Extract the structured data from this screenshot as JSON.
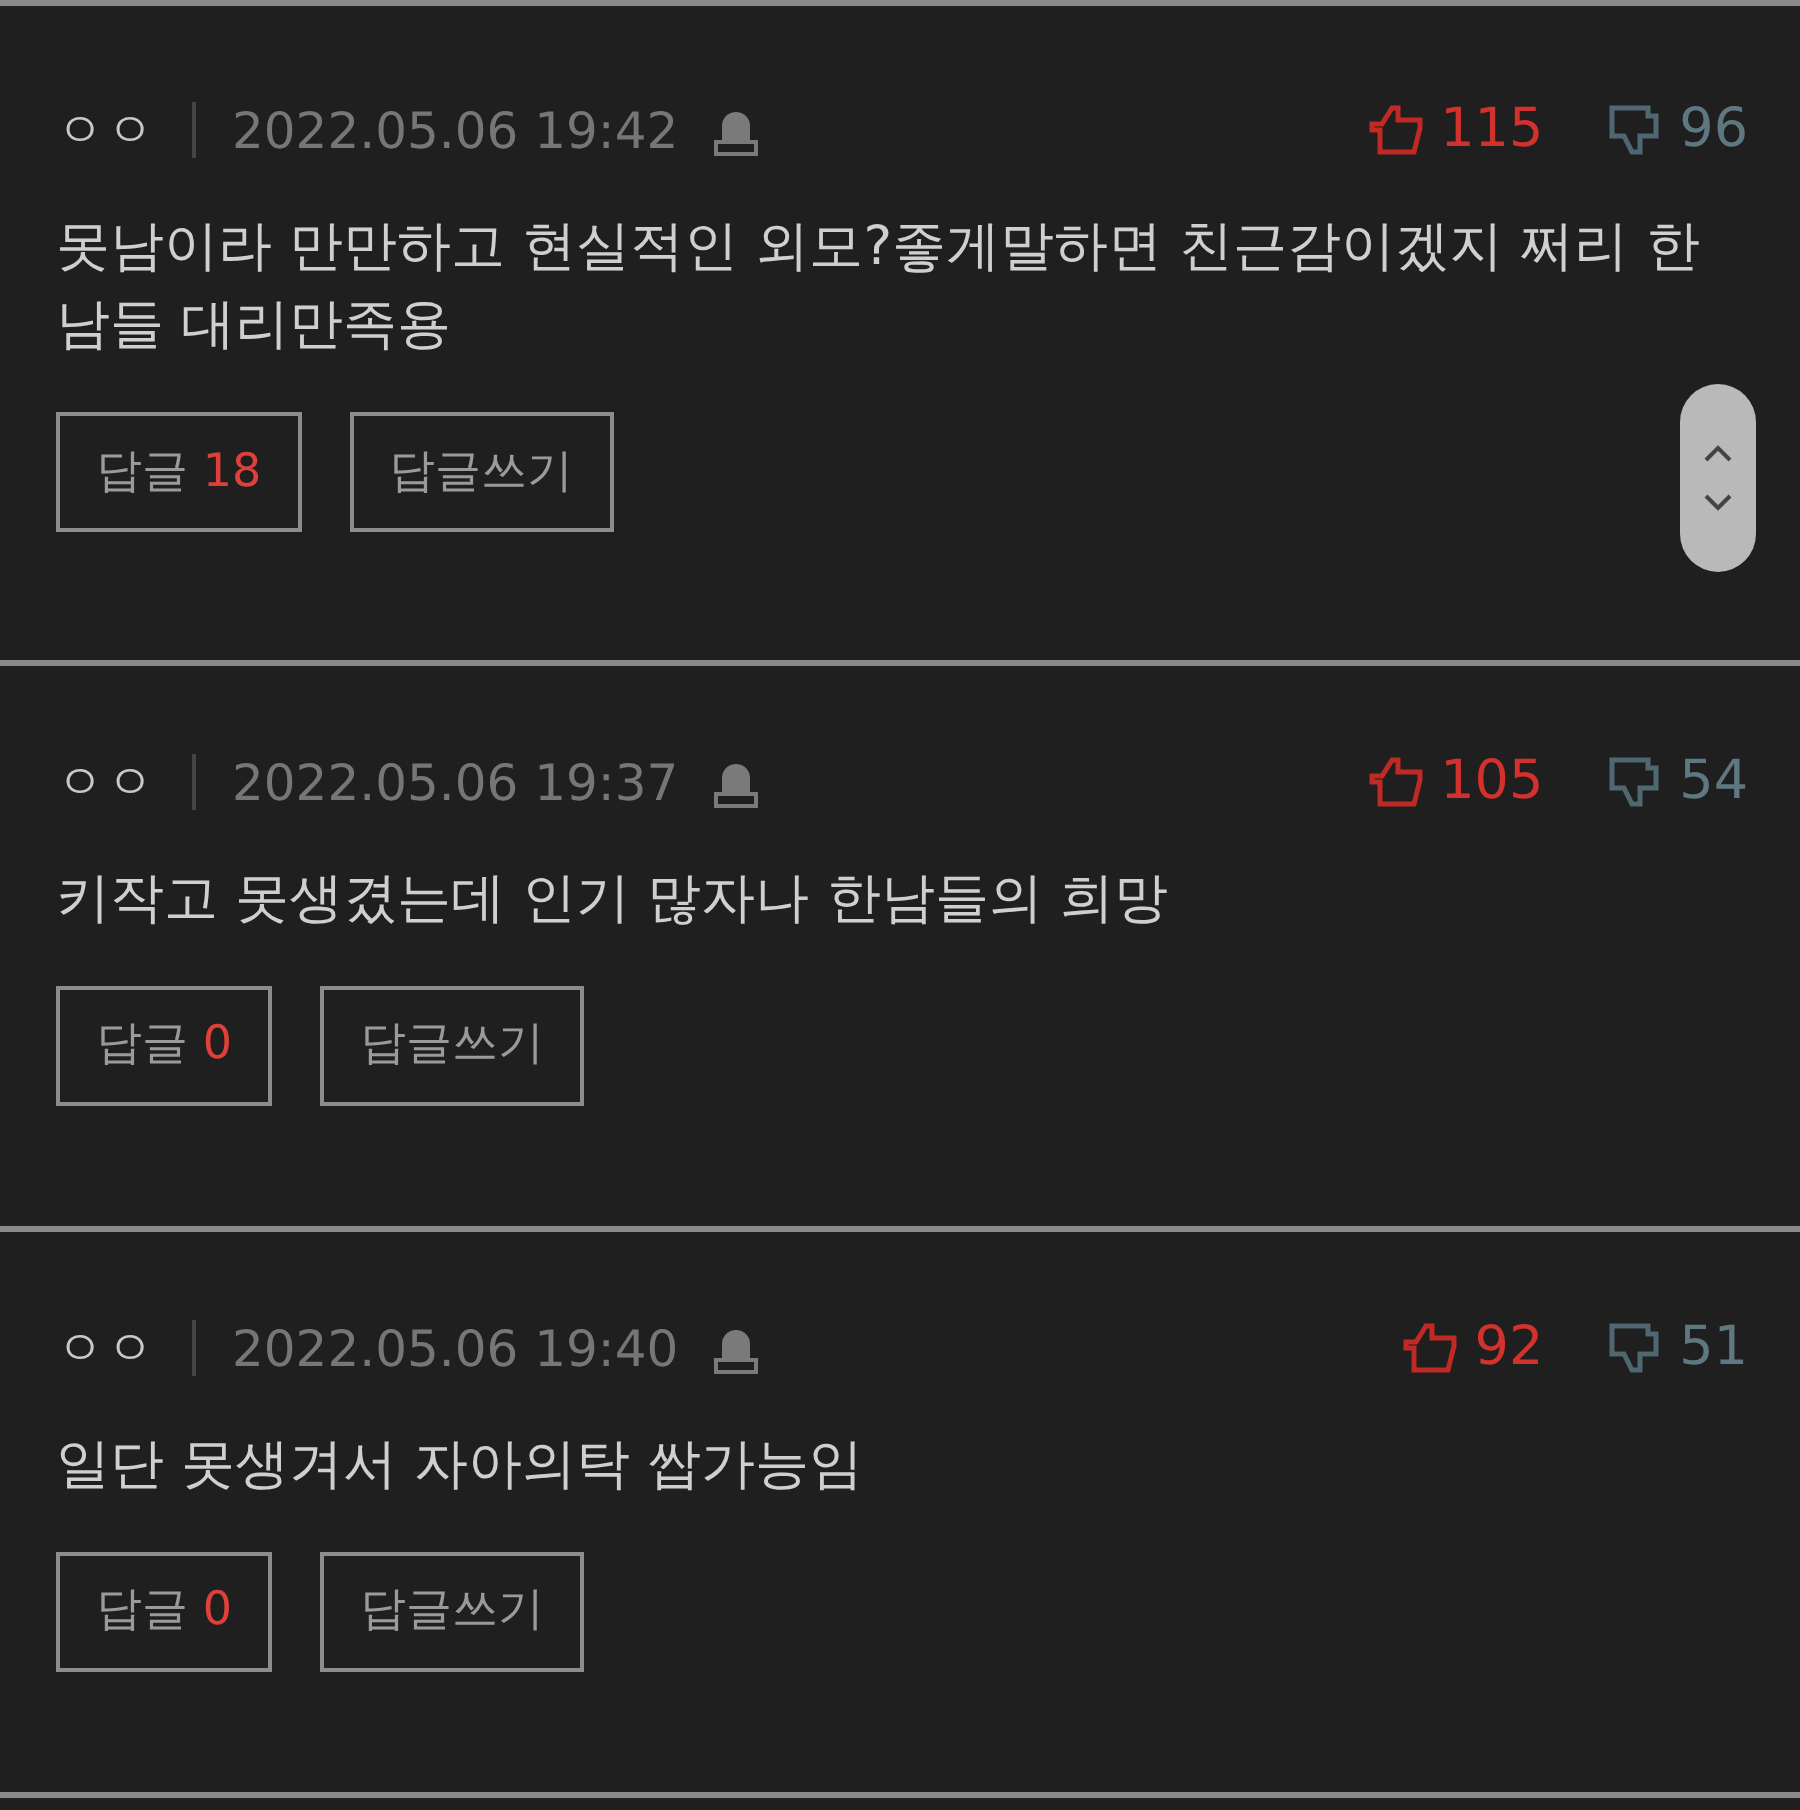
{
  "comments": [
    {
      "nickname": "ㅇㅇ",
      "date": "2022.05.06 19:42",
      "likes": "115",
      "dislikes": "96",
      "text": "못남이라 만만하고 현실적인 외모?좋게말하면 친근감이겠지 쩌리 한남들 대리만족용",
      "reply_label": "답글",
      "reply_count": "18",
      "write_label": "답글쓰기"
    },
    {
      "nickname": "ㅇㅇ",
      "date": "2022.05.06 19:37",
      "likes": "105",
      "dislikes": "54",
      "text": "키작고 못생겼는데 인기 많자나 한남들의 희망",
      "reply_label": "답글",
      "reply_count": "0",
      "write_label": "답글쓰기"
    },
    {
      "nickname": "ㅇㅇ",
      "date": "2022.05.06 19:40",
      "likes": "92",
      "dislikes": "51",
      "text": "일단 못생겨서 자아의탁 쌉가능임",
      "reply_label": "답글",
      "reply_count": "0",
      "write_label": "답글쓰기"
    }
  ]
}
